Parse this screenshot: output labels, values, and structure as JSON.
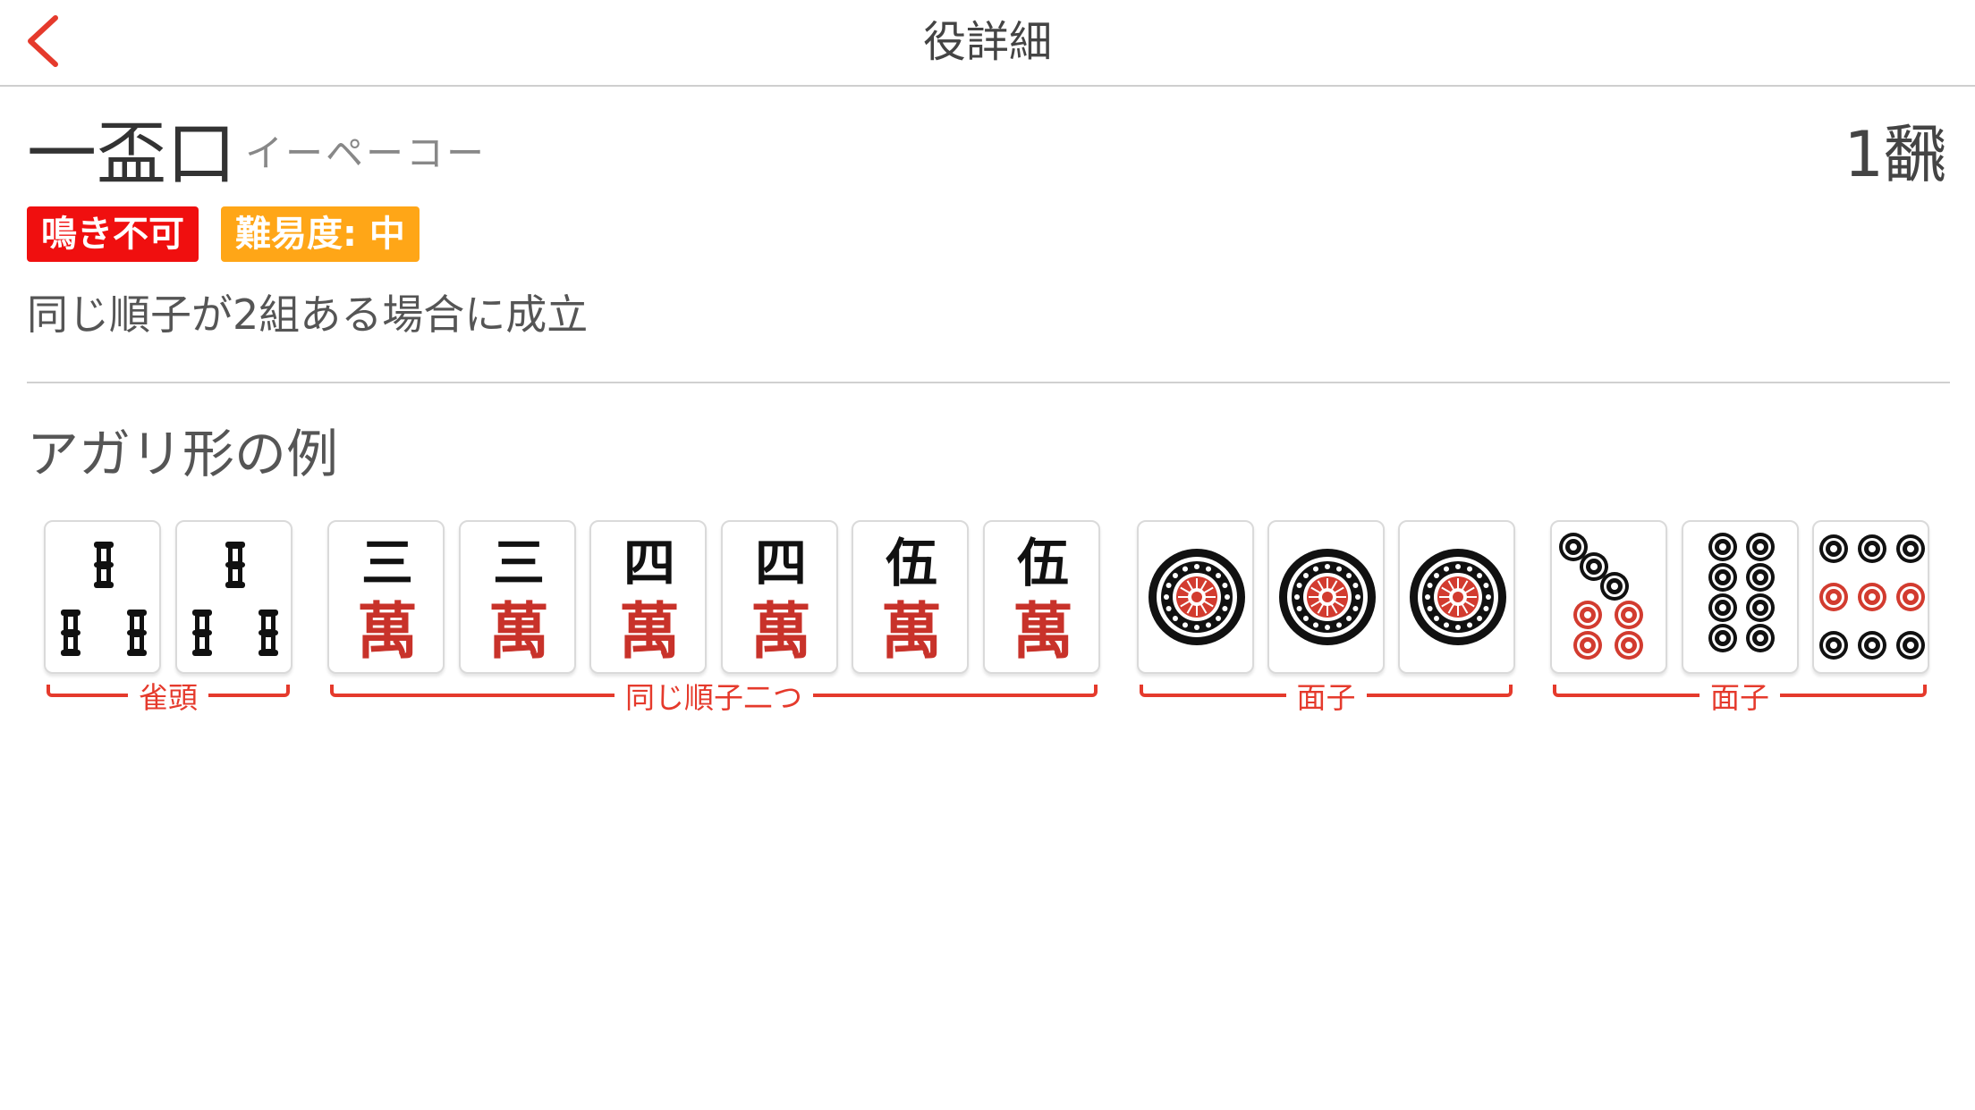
{
  "header": {
    "title": "役詳細",
    "back_icon": "chevron-left-icon",
    "accent": "#e53a2c"
  },
  "yaku": {
    "name": "一盃口",
    "reading": "イーペーコー",
    "han": "1飜",
    "badges": [
      {
        "label": "鳴き不可",
        "color": "#f00f0f"
      },
      {
        "label": "難易度: 中",
        "color": "#ffa617"
      }
    ],
    "description": "同じ順子が2組ある場合に成立"
  },
  "example": {
    "title": "アガリ形の例",
    "tiles": [
      {
        "suit": "sou",
        "rank": 3,
        "numeral": ""
      },
      {
        "suit": "sou",
        "rank": 3,
        "numeral": ""
      },
      {
        "suit": "man",
        "rank": 3,
        "numeral": "三",
        "glyph": "萬"
      },
      {
        "suit": "man",
        "rank": 3,
        "numeral": "三",
        "glyph": "萬"
      },
      {
        "suit": "man",
        "rank": 4,
        "numeral": "四",
        "glyph": "萬"
      },
      {
        "suit": "man",
        "rank": 4,
        "numeral": "四",
        "glyph": "萬"
      },
      {
        "suit": "man",
        "rank": 5,
        "numeral": "伍",
        "glyph": "萬"
      },
      {
        "suit": "man",
        "rank": 5,
        "numeral": "伍",
        "glyph": "萬"
      },
      {
        "suit": "pin",
        "rank": 1,
        "numeral": ""
      },
      {
        "suit": "pin",
        "rank": 1,
        "numeral": ""
      },
      {
        "suit": "pin",
        "rank": 1,
        "numeral": ""
      },
      {
        "suit": "pin",
        "rank": 7,
        "numeral": ""
      },
      {
        "suit": "pin",
        "rank": 8,
        "numeral": ""
      },
      {
        "suit": "pin",
        "rank": 9,
        "numeral": ""
      }
    ],
    "groups": [
      {
        "label": "雀頭"
      },
      {
        "label": "同じ順子二つ"
      },
      {
        "label": "面子"
      },
      {
        "label": "面子"
      }
    ]
  }
}
